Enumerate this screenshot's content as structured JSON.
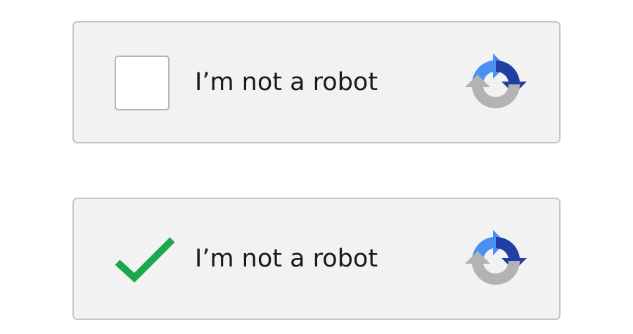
{
  "widgets": [
    {
      "state": "unchecked",
      "label": "I’m not a robot",
      "icon": "recaptcha-logo-icon"
    },
    {
      "state": "checked",
      "label": "I’m not a robot",
      "icon": "recaptcha-logo-icon"
    }
  ],
  "colors": {
    "panel_background": "#f2f2f2",
    "panel_border": "#c6c6c6",
    "checkmark_green": "#1aa84a",
    "logo_light_blue": "#4a90f2",
    "logo_dark_blue": "#1f3fa3",
    "logo_gray": "#b3b3b3"
  }
}
